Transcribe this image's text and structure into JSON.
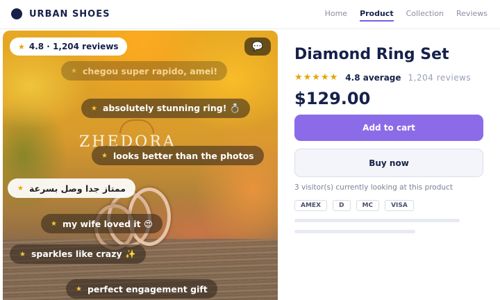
{
  "brand": {
    "name": "URBAN SHOES"
  },
  "nav": [
    {
      "label": "Home",
      "active": false
    },
    {
      "label": "Product",
      "active": true
    },
    {
      "label": "Collection",
      "active": false
    },
    {
      "label": "Reviews",
      "active": false
    }
  ],
  "media": {
    "rating_pill": "4.8 · 1,204 reviews",
    "chat_icon": "chat-bubble-icon",
    "watermark": "ZHEDORA",
    "reviews": [
      "chegou super rapido, amei!",
      "absolutely stunning ring! 💍",
      "looks better than the photos",
      "ممتاز جدا وصل بسرعة",
      "my wife loved it 😍",
      "sparkles like crazy ✨",
      "perfect engagement gift"
    ]
  },
  "product": {
    "title": "Diamond Ring Set",
    "stars": "★★★★★",
    "average": "4.8 average",
    "review_count": "1,204 reviews",
    "price": "$129.00",
    "add_to_cart": "Add to cart",
    "buy_now": "Buy now",
    "visitors": "3 visitor(s) currently looking at this product",
    "payments": [
      "AMEX",
      "D",
      "MC",
      "VISA"
    ]
  },
  "colors": {
    "accent": "#8c6be8",
    "navy": "#16214a",
    "star": "#e7a400"
  }
}
